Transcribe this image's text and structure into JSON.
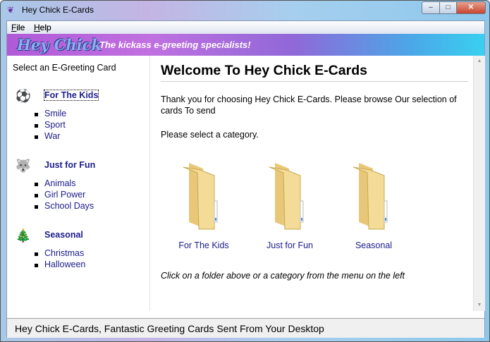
{
  "window": {
    "title": "Hey Chick E-Cards",
    "controls": {
      "minimize": "–",
      "maximize": "□",
      "close": "✕"
    }
  },
  "menu": [
    {
      "label": "File",
      "mnemonic": "F",
      "rest": "ile"
    },
    {
      "label": "Help",
      "mnemonic": "H",
      "rest": "elp"
    }
  ],
  "banner": {
    "logo": "Hey Chick",
    "tagline": "The kickass e-greeting specialists!"
  },
  "sidebar": {
    "heading": "Select an E-Greeting Card",
    "categories": [
      {
        "label": "For The Kids",
        "icon": "soccer-ball-icon",
        "items": [
          "Smile",
          "Sport",
          "War"
        ]
      },
      {
        "label": "Just for Fun",
        "icon": "husky-dog-icon",
        "items": [
          "Animals",
          "Girl Power",
          "School Days"
        ]
      },
      {
        "label": "Seasonal",
        "icon": "christmas-tree-icon",
        "items": [
          "Christmas",
          "Halloween"
        ]
      }
    ]
  },
  "main": {
    "title": "Welcome To Hey Chick E-Cards",
    "intro": "Thank you for choosing Hey Chick E-Cards. Please browse Our selection of cards To send",
    "prompt": "Please select a category.",
    "folders": [
      "For The Kids",
      "Just for Fun",
      "Seasonal"
    ],
    "hint": "Click on a folder above or a category from the menu on the left"
  },
  "status": "Hey Chick E-Cards, Fantastic Greeting Cards Sent From Your Desktop"
}
